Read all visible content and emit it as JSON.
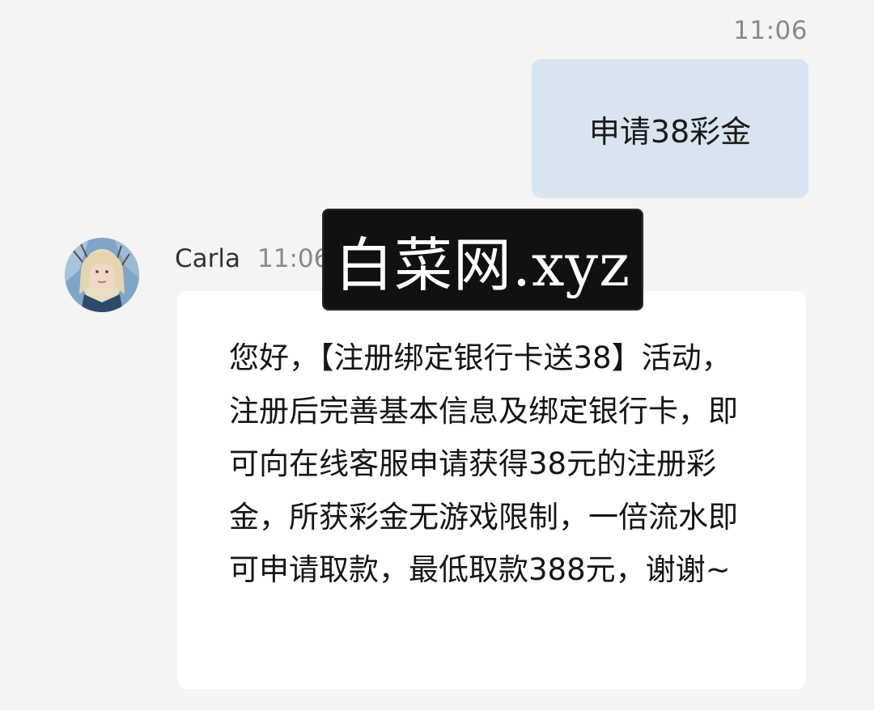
{
  "conversation": {
    "outgoing": {
      "time": "11:06",
      "text": "申请38彩金"
    },
    "incoming": {
      "sender": "Carla",
      "time": "11:06",
      "text": "您好，【注册绑定银行卡送38】活动，注册后完善基本信息及绑定银行卡，即可向在线客服申请获得38元的注册彩金，所获彩金无游戏限制，一倍流水即可申请取款，最低取款388元，谢谢~"
    }
  },
  "watermark": {
    "text": "白菜网.xyz"
  },
  "colors": {
    "background": "#f4f4f5",
    "outgoing_bubble": "#d8e5f0",
    "incoming_bubble": "#ffffff",
    "timestamp": "#8a8a8a",
    "watermark_bg": "#111111"
  }
}
